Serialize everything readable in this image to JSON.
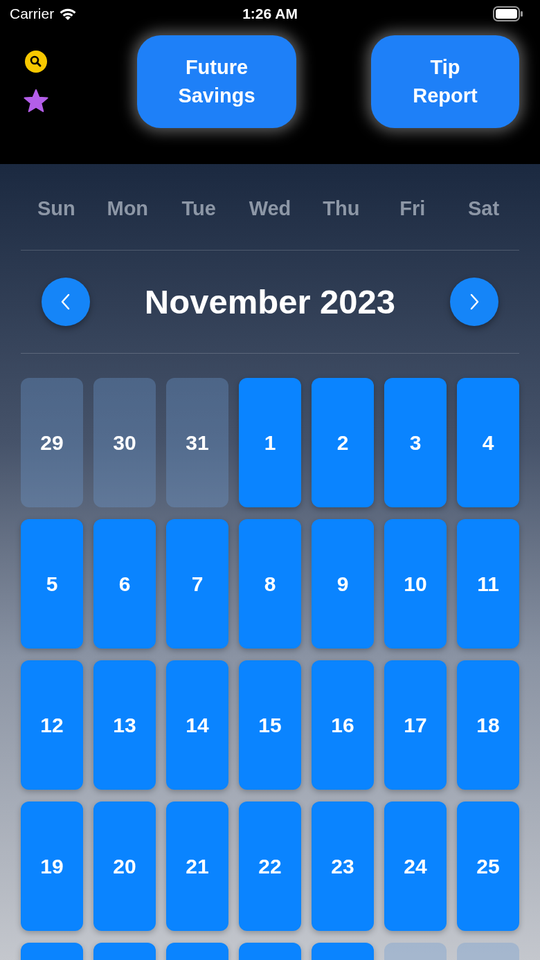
{
  "status_bar": {
    "carrier": "Carrier",
    "time": "1:26 AM"
  },
  "header": {
    "buttons": [
      {
        "label": "Future Savings"
      },
      {
        "label": "Tip Report"
      }
    ]
  },
  "weekdays": [
    "Sun",
    "Mon",
    "Tue",
    "Wed",
    "Thu",
    "Fri",
    "Sat"
  ],
  "month_title": "November 2023",
  "days": [
    {
      "label": "29",
      "in_month": false
    },
    {
      "label": "30",
      "in_month": false
    },
    {
      "label": "31",
      "in_month": false
    },
    {
      "label": "1",
      "in_month": true
    },
    {
      "label": "2",
      "in_month": true
    },
    {
      "label": "3",
      "in_month": true
    },
    {
      "label": "4",
      "in_month": true
    },
    {
      "label": "5",
      "in_month": true
    },
    {
      "label": "6",
      "in_month": true
    },
    {
      "label": "7",
      "in_month": true
    },
    {
      "label": "8",
      "in_month": true
    },
    {
      "label": "9",
      "in_month": true
    },
    {
      "label": "10",
      "in_month": true
    },
    {
      "label": "11",
      "in_month": true
    },
    {
      "label": "12",
      "in_month": true
    },
    {
      "label": "13",
      "in_month": true
    },
    {
      "label": "14",
      "in_month": true
    },
    {
      "label": "15",
      "in_month": true
    },
    {
      "label": "16",
      "in_month": true
    },
    {
      "label": "17",
      "in_month": true
    },
    {
      "label": "18",
      "in_month": true
    },
    {
      "label": "19",
      "in_month": true
    },
    {
      "label": "20",
      "in_month": true
    },
    {
      "label": "21",
      "in_month": true
    },
    {
      "label": "22",
      "in_month": true
    },
    {
      "label": "23",
      "in_month": true
    },
    {
      "label": "24",
      "in_month": true
    },
    {
      "label": "25",
      "in_month": true
    },
    {
      "in_month": true
    },
    {
      "in_month": true
    },
    {
      "in_month": true
    },
    {
      "in_month": true
    },
    {
      "in_month": true
    },
    {
      "in_month": false
    },
    {
      "in_month": false
    }
  ]
}
